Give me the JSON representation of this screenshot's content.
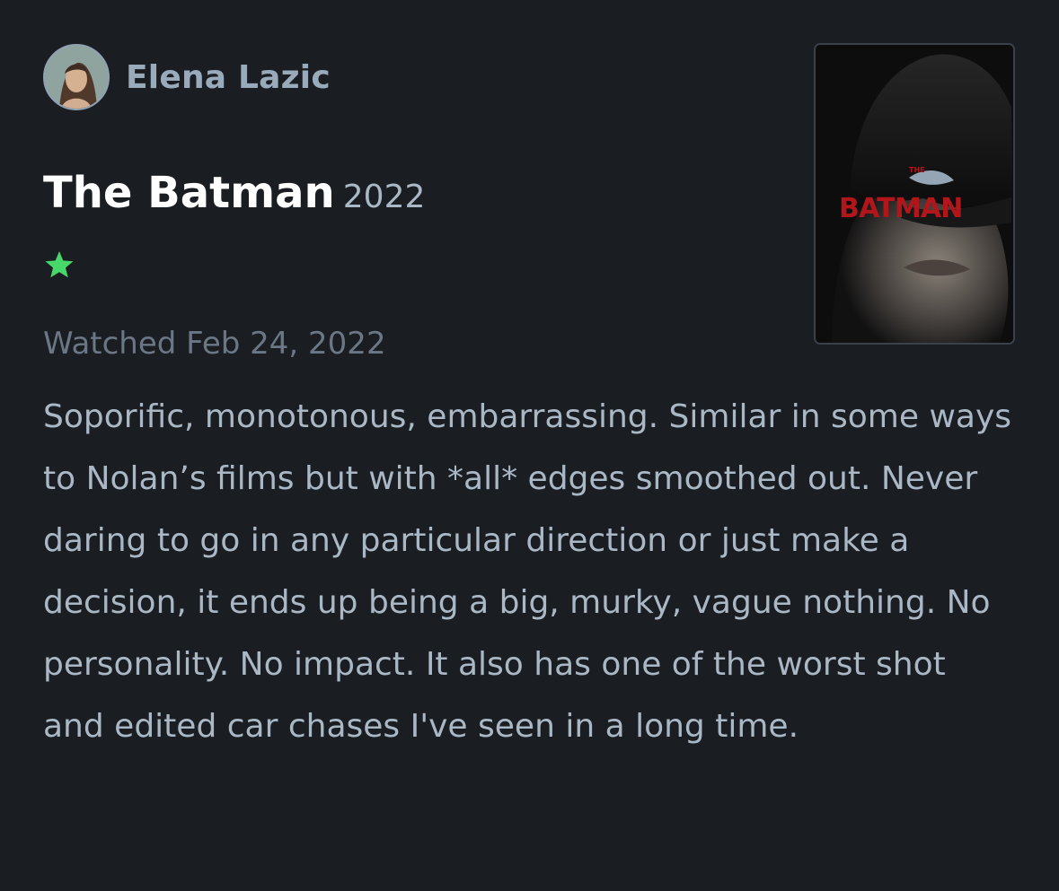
{
  "author": {
    "name": "Elena Lazic",
    "avatar_icon": "avatar-photo"
  },
  "film": {
    "title": "The Batman",
    "year": "2022",
    "poster_label": "THE BATMAN",
    "poster_icon": "movie-poster"
  },
  "rating": {
    "stars": 1,
    "max": 5,
    "icon": "star-icon",
    "color": "#47d76b"
  },
  "watched": "Watched Feb 24, 2022",
  "review": "Soporific, monotonous, embarrassing. Similar in some ways to Nolan’s films but with *all* edges smoothed out. Never daring to go in any particular direction or just make a decision, it ends up being a big, murky, vague nothing. No personality. No impact. It also has one of the worst shot and edited car chases I've seen in a long time.",
  "colors": {
    "background": "#1a1d21",
    "primary_text": "#ffffff",
    "secondary_text": "#aab8c6",
    "muted_text": "#6b7785"
  }
}
